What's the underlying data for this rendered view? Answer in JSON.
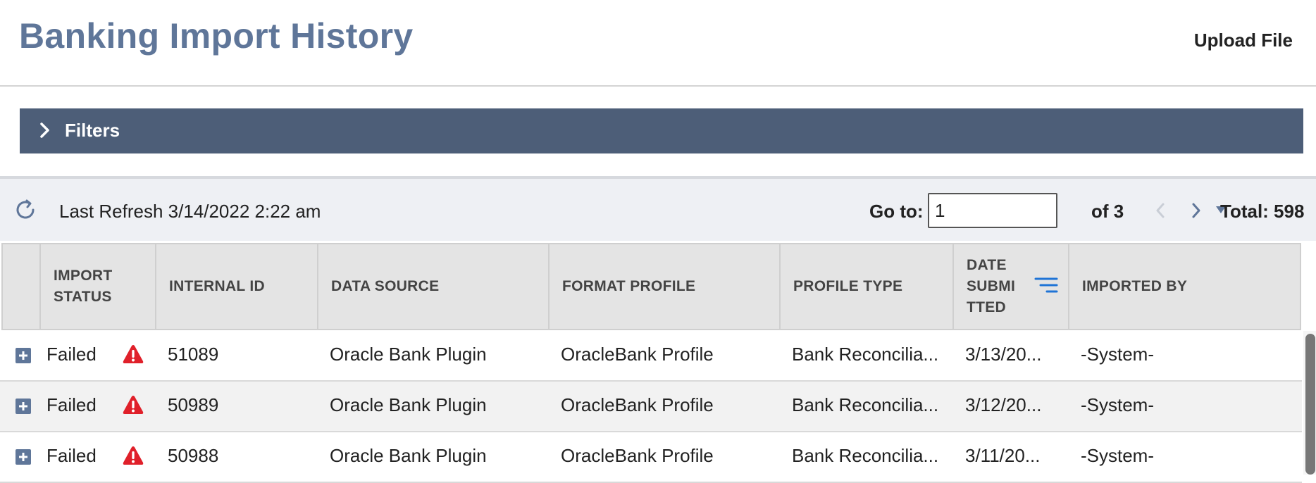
{
  "page": {
    "title": "Banking Import History",
    "upload_label": "Upload File"
  },
  "filters": {
    "label": "Filters"
  },
  "toolbar": {
    "last_refresh": "Last Refresh 3/14/2022 2:22 am",
    "goto_label": "Go to:",
    "page_value": "1",
    "of_pages": "of 3",
    "total": "Total: 598"
  },
  "columns": [
    {
      "line1": "IMPORT",
      "line2": "STATUS"
    },
    {
      "line1": "INTERNAL ID"
    },
    {
      "line1": "DATA SOURCE"
    },
    {
      "line1": "FORMAT PROFILE"
    },
    {
      "line1": "PROFILE TYPE"
    },
    {
      "line1": "DATE",
      "line2": "SUBMI",
      "line3": "TTED"
    },
    {
      "line1": "IMPORTED BY"
    }
  ],
  "rows": [
    {
      "status": "Failed",
      "internal_id": "51089",
      "data_source": "Oracle Bank Plugin",
      "format_profile": "OracleBank Profile",
      "profile_type": "Bank Reconcilia...",
      "date_submitted": "3/13/20...",
      "imported_by": "-System-"
    },
    {
      "status": "Failed",
      "internal_id": "50989",
      "data_source": "Oracle Bank Plugin",
      "format_profile": "OracleBank Profile",
      "profile_type": "Bank Reconcilia...",
      "date_submitted": "3/12/20...",
      "imported_by": "-System-"
    },
    {
      "status": "Failed",
      "internal_id": "50988",
      "data_source": "Oracle Bank Plugin",
      "format_profile": "OracleBank Profile",
      "profile_type": "Bank Reconcilia...",
      "date_submitted": "3/11/20...",
      "imported_by": "-System-"
    }
  ],
  "colors": {
    "title": "#5f7699",
    "filters_bar": "#4d5e78",
    "error": "#e0202a",
    "sort_icon": "#1f74d6"
  },
  "icons": [
    "chevron-right-icon",
    "refresh-icon",
    "chevron-left-icon",
    "caret-down-icon",
    "sort-icon",
    "plus-box-icon",
    "warning-icon"
  ]
}
